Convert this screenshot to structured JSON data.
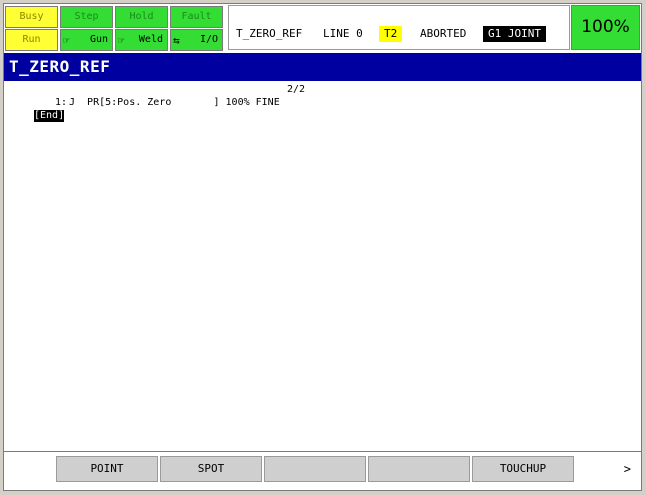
{
  "lamps": {
    "busy": "Busy",
    "step": "Step",
    "hold": "Hold",
    "fault": "Fault",
    "run": "Run",
    "gun": "Gun",
    "weld": "Weld",
    "io": "I/O"
  },
  "status": {
    "program": "T_ZERO_REF",
    "line": "LINE 0",
    "mode": "T2",
    "state": "ABORTED",
    "group": "G1 JOINT",
    "override": "100%"
  },
  "title": "T_ZERO_REF",
  "editor": {
    "line_counter": "2/2",
    "lines": [
      {
        "number": "1:",
        "text": "J  PR[5:Pos. Zero       ] 100% FINE"
      }
    ],
    "end_marker": "[End]"
  },
  "function_keys": [
    "",
    "POINT",
    "SPOT",
    "",
    "",
    "TOUCHUP"
  ],
  "next_page": ">",
  "colors": {
    "lamp_green": "#33dd33",
    "lamp_yellow": "#ffff33",
    "title_bar": "#0000a0",
    "mode_badge": "#ffff00"
  },
  "icons": [
    "gun-icon",
    "weld-icon",
    "io-icon"
  ]
}
